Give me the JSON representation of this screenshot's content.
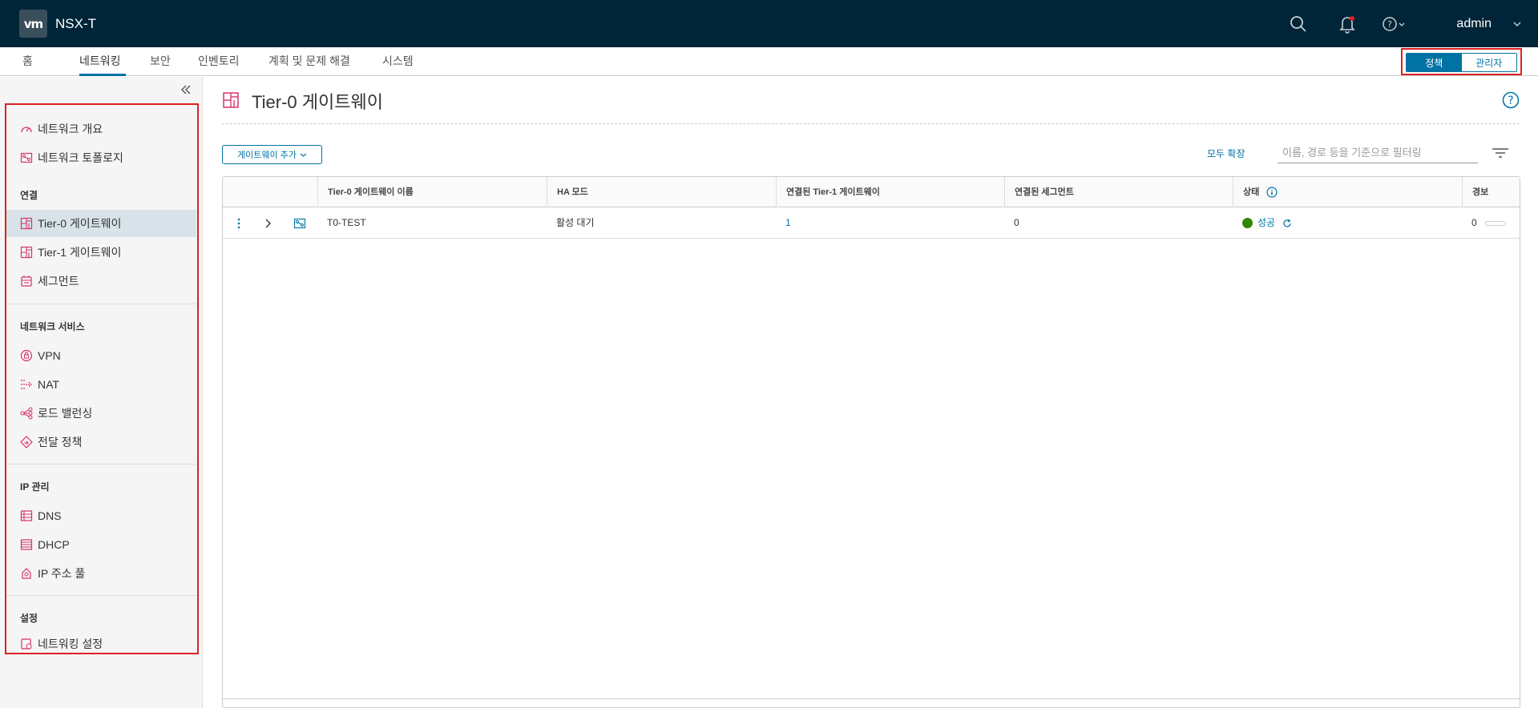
{
  "header": {
    "logo": "vm",
    "title": "NSX-T",
    "user": "admin"
  },
  "nav": {
    "tabs": [
      {
        "label": "홈"
      },
      {
        "label": "네트워킹"
      },
      {
        "label": "보안"
      },
      {
        "label": "인벤토리"
      },
      {
        "label": "계획 및 문제 해결"
      },
      {
        "label": "시스템"
      }
    ],
    "active": "네트워킹",
    "mode_toggle": {
      "policy": "정책",
      "manager": "관리자",
      "selected": "정책"
    }
  },
  "sidebar": {
    "items_top": [
      {
        "label": "네트워크 개요",
        "icon": "gauge-icon"
      },
      {
        "label": "네트워크 토폴로지",
        "icon": "topology-icon"
      }
    ],
    "sections": [
      {
        "title": "연결",
        "items": [
          {
            "label": "Tier-0 게이트웨이",
            "icon": "gateway-icon",
            "active": true
          },
          {
            "label": "Tier-1 게이트웨이",
            "icon": "gateway-icon"
          },
          {
            "label": "세그먼트",
            "icon": "segment-icon"
          }
        ]
      },
      {
        "title": "네트워크 서비스",
        "items": [
          {
            "label": "VPN",
            "icon": "vpn-icon"
          },
          {
            "label": "NAT",
            "icon": "nat-icon"
          },
          {
            "label": "로드 밸런싱",
            "icon": "load-balancer-icon"
          },
          {
            "label": "전달 정책",
            "icon": "forwarding-policy-icon"
          }
        ]
      },
      {
        "title": "IP 관리",
        "items": [
          {
            "label": "DNS",
            "icon": "dns-icon"
          },
          {
            "label": "DHCP",
            "icon": "dhcp-icon"
          },
          {
            "label": "IP 주소 풀",
            "icon": "ip-pool-icon"
          }
        ]
      },
      {
        "title": "설정",
        "items": [
          {
            "label": "네트워킹 설정",
            "icon": "settings-icon"
          }
        ]
      }
    ]
  },
  "page": {
    "title": "Tier-0 게이트웨이",
    "add_button": "게이트웨이 추가",
    "expand_all": "모두 확장",
    "filter_placeholder": "이름, 경로 등을 기준으로 필터링"
  },
  "table": {
    "columns": [
      "Tier-0 게이트웨이 이름",
      "HA 모드",
      "연결된 Tier-1 게이트웨이",
      "연결된 세그먼트",
      "상태",
      "경보"
    ],
    "rows": [
      {
        "name": "T0-TEST",
        "ha_mode": "활성 대기",
        "tier1": "1",
        "segments": "0",
        "status": "성공",
        "alarms": "0"
      }
    ]
  },
  "colors": {
    "header_bg": "#002538",
    "accent": "#0072a3",
    "icon_pink": "#d6336c",
    "success": "#318700",
    "highlight_outline": "#e02020"
  }
}
